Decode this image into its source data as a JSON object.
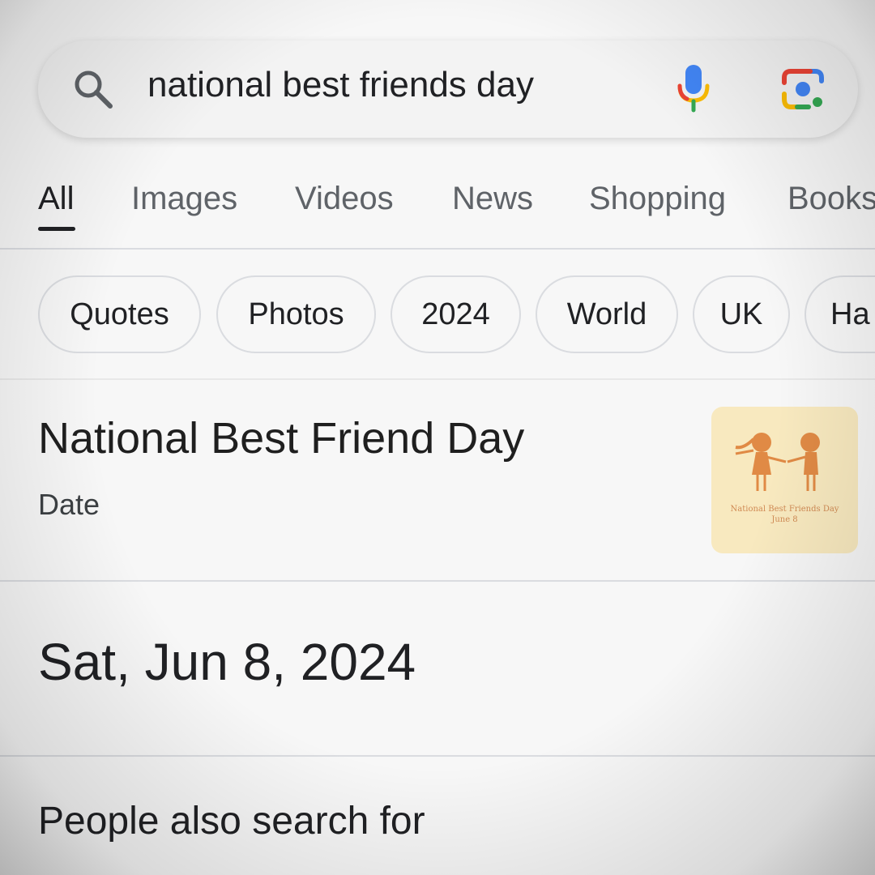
{
  "search": {
    "query": "national best friends day"
  },
  "tabs": [
    {
      "label": "All",
      "active": true
    },
    {
      "label": "Images"
    },
    {
      "label": "Videos"
    },
    {
      "label": "News"
    },
    {
      "label": "Shopping"
    },
    {
      "label": "Books"
    }
  ],
  "chips": [
    {
      "label": "Quotes"
    },
    {
      "label": "Photos"
    },
    {
      "label": "2024"
    },
    {
      "label": "World"
    },
    {
      "label": "UK"
    },
    {
      "label": "Ha"
    }
  ],
  "knowledge_panel": {
    "title": "National Best Friend Day",
    "subtitle": "Date",
    "thumbnail_caption": "National Best Friends Day",
    "thumbnail_caption_line2": "June 8",
    "value": "Sat, Jun 8, 2024"
  },
  "people_also_search": {
    "heading": "People also search for"
  },
  "icons": {
    "search": "search-icon",
    "mic": "mic-icon",
    "lens": "lens-icon"
  },
  "colors": {
    "google_blue": "#4285f4",
    "google_red": "#ea4335",
    "google_yellow": "#fbbc05",
    "google_green": "#34a853",
    "thumbnail_bg": "#f8e9bf",
    "figure_orange": "#e08a45"
  }
}
